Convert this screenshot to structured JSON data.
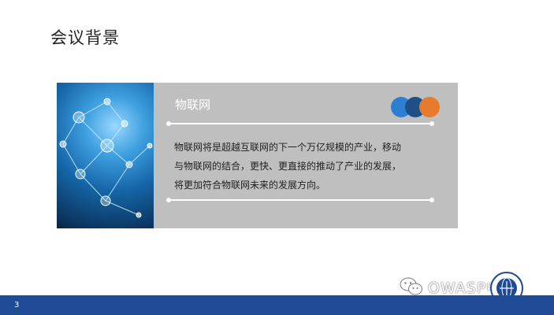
{
  "slide": {
    "title": "会议背景",
    "page_number": "3"
  },
  "card": {
    "title": "物联网",
    "body_lines": [
      "物联网将是超越互联网的下一个万亿规模的产业，移动",
      "与物联网的结合，更快、更直接的推动了产业的发展，",
      "将更加符合物联网未来的发展方向。"
    ],
    "accent_colors": [
      "#2d7fd4",
      "#1f4f86",
      "#e67b2e"
    ]
  },
  "footer": {
    "bar_color": "#1f4a96"
  },
  "watermark": {
    "text": "OWASP中国",
    "icon": "wechat-icon"
  },
  "seal": {
    "icon": "owasp-china-seal-icon"
  }
}
